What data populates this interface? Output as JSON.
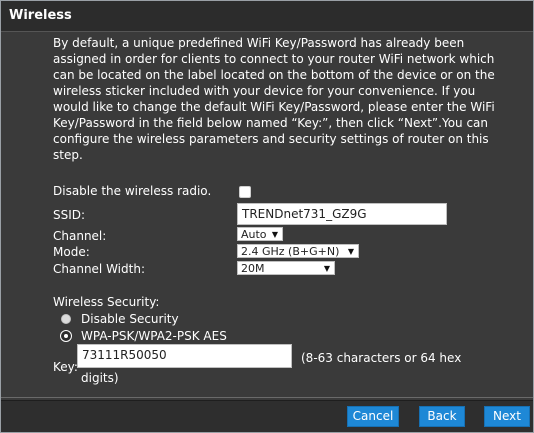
{
  "header": {
    "title": "Wireless"
  },
  "intro": {
    "text": "By default, a unique predefined WiFi Key/Password has already been assigned in order for clients to connect to your router WiFi network which can be located on the label located on the bottom of the device or on the wireless sticker included with your device for your convenience. If you would like to change the default WiFi Key/Password, please enter the WiFi Key/Password in the field below named “Key:”, then click “Next”.You can configure the wireless parameters and security settings of router on this step."
  },
  "form": {
    "disable_radio_label": "Disable the wireless radio.",
    "disable_radio_checked": false,
    "ssid_label": "SSID:",
    "ssid_value": "TRENDnet731_GZ9G",
    "channel_label": "Channel:",
    "channel_value": "Auto",
    "mode_label": "Mode:",
    "mode_value": "2.4 GHz (B+G+N)",
    "width_label": "Channel Width:",
    "width_value": "20M"
  },
  "security": {
    "label": "Wireless Security:",
    "option_disable": "Disable Security",
    "option_wpa": "WPA-PSK/WPA2-PSK AES",
    "selected": "WPA-PSK/WPA2-PSK AES",
    "key_label": "Key:",
    "key_value": "73111R50050",
    "key_hint": "(8-63 characters or 64 hex",
    "key_hint_line2": "digits)"
  },
  "footer": {
    "cancel_label": "Cancel",
    "back_label": "Back",
    "next_label": "Next"
  },
  "colors": {
    "panel_background": "#3a3a3a",
    "header_background": "#2c2c2c",
    "button_blue": "#1e88d6"
  }
}
